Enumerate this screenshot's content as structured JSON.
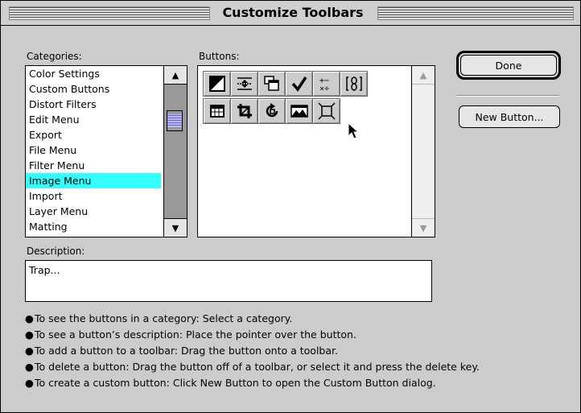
{
  "window": {
    "title": "Customize Toolbars"
  },
  "categories": {
    "label": "Categories:",
    "items": [
      "Color Settings",
      "Custom Buttons",
      "Distort Filters",
      "Edit Menu",
      "Export",
      "File Menu",
      "Filter Menu",
      "Image Menu",
      "Import",
      "Layer Menu",
      "Matting"
    ],
    "selected": "Image Menu"
  },
  "buttons_panel": {
    "label": "Buttons:",
    "icons": [
      "black-white-swatch-icon",
      "trim-sort-icon",
      "copy-layers-icon",
      "checkmark-icon",
      "math-operators-icon",
      "link-chain-icon",
      "grid-table-icon",
      "crop-icon",
      "rotate-icon",
      "landscape-image-icon",
      "trap-frame-icon"
    ]
  },
  "actions": {
    "done_label": "Done",
    "new_button_label": "New Button..."
  },
  "description": {
    "label": "Description:",
    "value": "Trap..."
  },
  "instructions": [
    "To see the buttons in a category: Select a category.",
    "To see a button’s description: Place the pointer over the button.",
    "To add a button to a toolbar: Drag the button onto a toolbar.",
    "To delete a button: Drag the button off of a toolbar, or select it and press the delete key.",
    "To create a custom button: Click New Button to open the Custom Button dialog."
  ],
  "colors": {
    "selection": "#33ffff",
    "window_bg": "#cccccc"
  }
}
